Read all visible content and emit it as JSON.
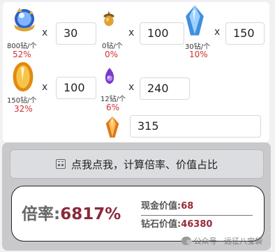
{
  "items": [
    {
      "id": "blue-orb",
      "price": "800钻/个",
      "pct": "52%",
      "times": "x",
      "qty": "30"
    },
    {
      "id": "acorn",
      "price": "0钻/个",
      "pct": "0%",
      "times": "x",
      "qty": "100"
    },
    {
      "id": "blue-crystal",
      "price": "30钻/个",
      "pct": "10%",
      "times": "x",
      "qty": "150"
    },
    {
      "id": "gold-crystal",
      "price": "150钻/个",
      "pct": "32%",
      "times": "x",
      "qty": "100"
    },
    {
      "id": "purple-flame",
      "price": "12钻/个",
      "pct": "6%",
      "times": "x",
      "qty": "240"
    },
    {
      "id": "orange-crystal",
      "qty": "315"
    }
  ],
  "calculate_button": {
    "label": "点我点我，计算倍率、价值占比",
    "icon": "calculator-icon"
  },
  "result": {
    "rate_label": "倍率:",
    "rate_value": "6817%",
    "cash_label": "现金价值:",
    "cash_value": "68",
    "diamond_label": "钻石价值:",
    "diamond_value": "46380"
  },
  "watermark": "公众号 · 远征八宝袋",
  "colors": {
    "percent_red": "#d03030",
    "rate_red": "#8a2a3a",
    "panel_grey": "#c9c9cc"
  }
}
